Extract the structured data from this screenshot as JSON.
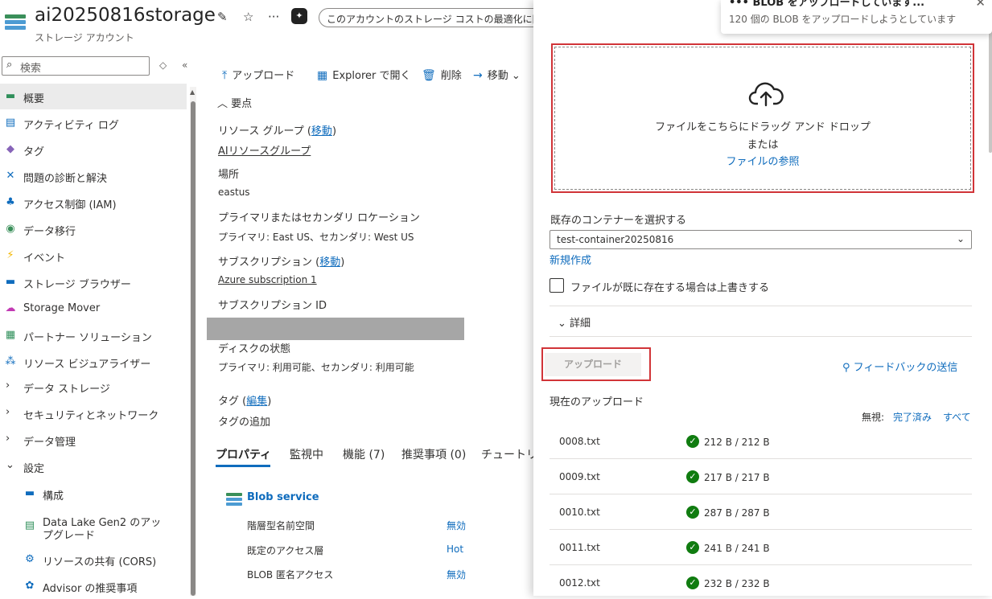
{
  "header": {
    "title": "ai20250816storage",
    "subtitle": "ストレージ アカウント",
    "banner": "このアカウントのストレージ コストの最適化に関"
  },
  "sidebar": {
    "search_placeholder": "検索",
    "items": [
      {
        "label": "概要",
        "icon": "overview-icon",
        "glyph": "▬"
      },
      {
        "label": "アクティビティ ログ",
        "icon": "activity-log-icon",
        "glyph": "▤"
      },
      {
        "label": "タグ",
        "icon": "tag-icon",
        "glyph": "◆"
      },
      {
        "label": "問題の診断と解決",
        "icon": "wrench-icon",
        "glyph": "✕"
      },
      {
        "label": "アクセス制御 (IAM)",
        "icon": "people-icon",
        "glyph": "♣"
      },
      {
        "label": "データ移行",
        "icon": "data-migration-icon",
        "glyph": "◉"
      },
      {
        "label": "イベント",
        "icon": "lightning-icon",
        "glyph": "⚡"
      },
      {
        "label": "ストレージ ブラウザー",
        "icon": "storage-browser-icon",
        "glyph": "▬"
      },
      {
        "label": "Storage Mover",
        "icon": "cloud-icon",
        "glyph": "☁"
      },
      {
        "label": "パートナー ソリューション",
        "icon": "partner-icon",
        "glyph": "▦"
      },
      {
        "label": "リソース ビジュアライザー",
        "icon": "visualizer-icon",
        "glyph": "⁂"
      }
    ],
    "groups": [
      {
        "label": "データ ストレージ"
      },
      {
        "label": "セキュリティとネットワーク"
      },
      {
        "label": "データ管理"
      },
      {
        "label": "設定"
      }
    ],
    "sub_items": [
      {
        "label": "構成",
        "icon": "config-icon",
        "glyph": "▬"
      },
      {
        "label": "Data Lake Gen2 のアッ",
        "label2": "プグレード",
        "icon": "data-lake-icon",
        "glyph": "▤"
      },
      {
        "label": "リソースの共有 (CORS)",
        "icon": "cors-icon",
        "glyph": "⚙"
      },
      {
        "label": "Advisor の推奨事項",
        "icon": "advisor-icon",
        "glyph": "✿"
      }
    ]
  },
  "toolbar": {
    "upload": "アップロード",
    "explorer": "Explorer で開く",
    "delete": "削除",
    "move": "移動"
  },
  "essentials": {
    "header": "要点",
    "resource_group_label": "リソース グループ",
    "move_link": "移動",
    "resource_group": "AIリソースグループ",
    "location_label": "場所",
    "location": "eastus",
    "primary_secondary_label": "プライマリまたはセカンダリ ロケーション",
    "primary_secondary": "プライマリ: East US、セカンダリ: West US",
    "subscription_label": "サブスクリプション",
    "subscription": "Azure subscription 1",
    "subscription_id_label": "サブスクリプション ID",
    "disk_state_label": "ディスクの状態",
    "disk_state": "プライマリ: 利用可能、セカンダリ: 利用可能",
    "tags_label": "タグ",
    "edit_link": "編集",
    "add_tag": "タグの追加"
  },
  "prop_tabs": [
    "プロパティ",
    "監視中",
    "機能 (7)",
    "推奨事項 (0)",
    "チュートリ"
  ],
  "blob_service": {
    "title": "Blob service",
    "rows": [
      {
        "label": "階層型名前空間",
        "value": "無効"
      },
      {
        "label": "既定のアクセス層",
        "value": "Hot"
      },
      {
        "label": "BLOB 匿名アクセス",
        "value": "無効"
      }
    ]
  },
  "upload_panel": {
    "drop_text": "ファイルをこちらにドラッグ アンド ドロップ",
    "or_text": "または",
    "browse": "ファイルの参照",
    "container_label": "既存のコンテナーを選択する",
    "container_value": "test-container20250816",
    "new_link": "新規作成",
    "overwrite_label": "ファイルが既に存在する場合は上書きする",
    "details": "詳細",
    "upload_button": "アップロード",
    "feedback": "フィードバックの送信",
    "current_uploads": "現在のアップロード",
    "ignore_label": "無視:",
    "completed_link": "完了済み",
    "all_link": "すべて",
    "uploads": [
      {
        "name": "0008.txt",
        "size": "212 B / 212 B"
      },
      {
        "name": "0009.txt",
        "size": "217 B / 217 B"
      },
      {
        "name": "0010.txt",
        "size": "287 B / 287 B"
      },
      {
        "name": "0011.txt",
        "size": "241 B / 241 B"
      },
      {
        "name": "0012.txt",
        "size": "232 B / 232 B"
      }
    ]
  },
  "toast": {
    "title": "BLOB をアップロードしています...",
    "message": "120 個の BLOB をアップロードしようとしています"
  },
  "colors": {
    "accent": "#0f6cbd",
    "highlight_border": "#d13438",
    "success": "#107c10"
  }
}
